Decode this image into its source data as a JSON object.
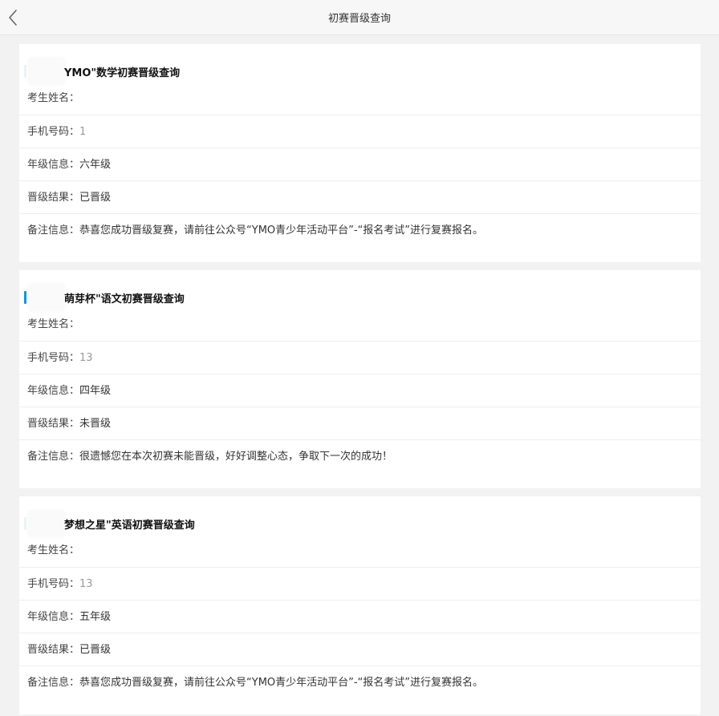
{
  "header": {
    "title": "初赛晋级查询",
    "back_icon": "chevron-left-icon"
  },
  "colors": {
    "accent_blue": "#1296db",
    "accent_faint": "#e8f3fb"
  },
  "cards": [
    {
      "title": "YMO\"数学初赛晋级查询",
      "accent_color": "#e8f3fb",
      "rows": [
        {
          "label": "考生姓名：",
          "value": ""
        },
        {
          "label": "手机号码：",
          "value": "1"
        },
        {
          "label": "年级信息：",
          "value": "六年级"
        },
        {
          "label": "晋级结果：",
          "value": "已晋级"
        },
        {
          "label": "备注信息：",
          "value": "恭喜您成功晋级复赛，请前往公众号“YMO青少年活动平台”-“报名考试”进行复赛报名。"
        }
      ]
    },
    {
      "title": "萌芽杯\"语文初赛晋级查询",
      "accent_color": "#1296db",
      "rows": [
        {
          "label": "考生姓名：",
          "value": ""
        },
        {
          "label": "手机号码：",
          "value": "13"
        },
        {
          "label": "年级信息：",
          "value": "四年级"
        },
        {
          "label": "晋级结果：",
          "value": "未晋级"
        },
        {
          "label": "备注信息：",
          "value": "很遗憾您在本次初赛未能晋级，好好调整心态，争取下一次的成功！"
        }
      ]
    },
    {
      "title": "梦想之星\"英语初赛晋级查询",
      "accent_color": "#e8f3fb",
      "rows": [
        {
          "label": "考生姓名：",
          "value": ""
        },
        {
          "label": "手机号码：",
          "value": "13"
        },
        {
          "label": "年级信息：",
          "value": "五年级"
        },
        {
          "label": "晋级结果：",
          "value": "已晋级"
        },
        {
          "label": "备注信息：",
          "value": "恭喜您成功晋级复赛，请前往公众号“YMO青少年活动平台”-“报名考试”进行复赛报名。"
        }
      ]
    }
  ]
}
